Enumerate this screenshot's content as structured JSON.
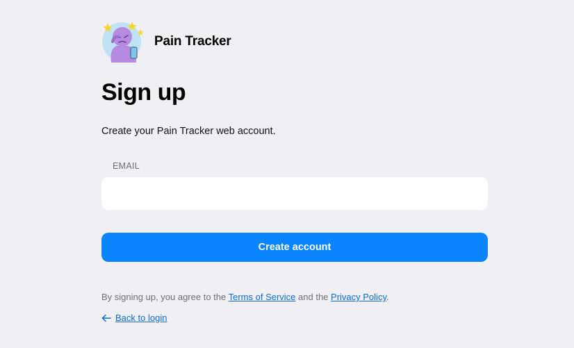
{
  "brand": {
    "name": "Pain Tracker",
    "logo_icon": "pain-character-logo-icon"
  },
  "header": {
    "title": "Sign up",
    "subtitle": "Create your Pain Tracker web account."
  },
  "form": {
    "email_label": "EMAIL",
    "email_value": "",
    "email_placeholder": "",
    "submit_label": "Create account"
  },
  "legal": {
    "prefix": "By signing up, you agree to the ",
    "terms_label": "Terms of Service",
    "middle": " and the ",
    "privacy_label": "Privacy Policy",
    "suffix": "."
  },
  "back": {
    "icon": "arrow-left-icon",
    "label": "Back to login"
  },
  "colors": {
    "background": "#f0eff4",
    "accent": "#0a84ff",
    "link": "#0a6cd6"
  }
}
